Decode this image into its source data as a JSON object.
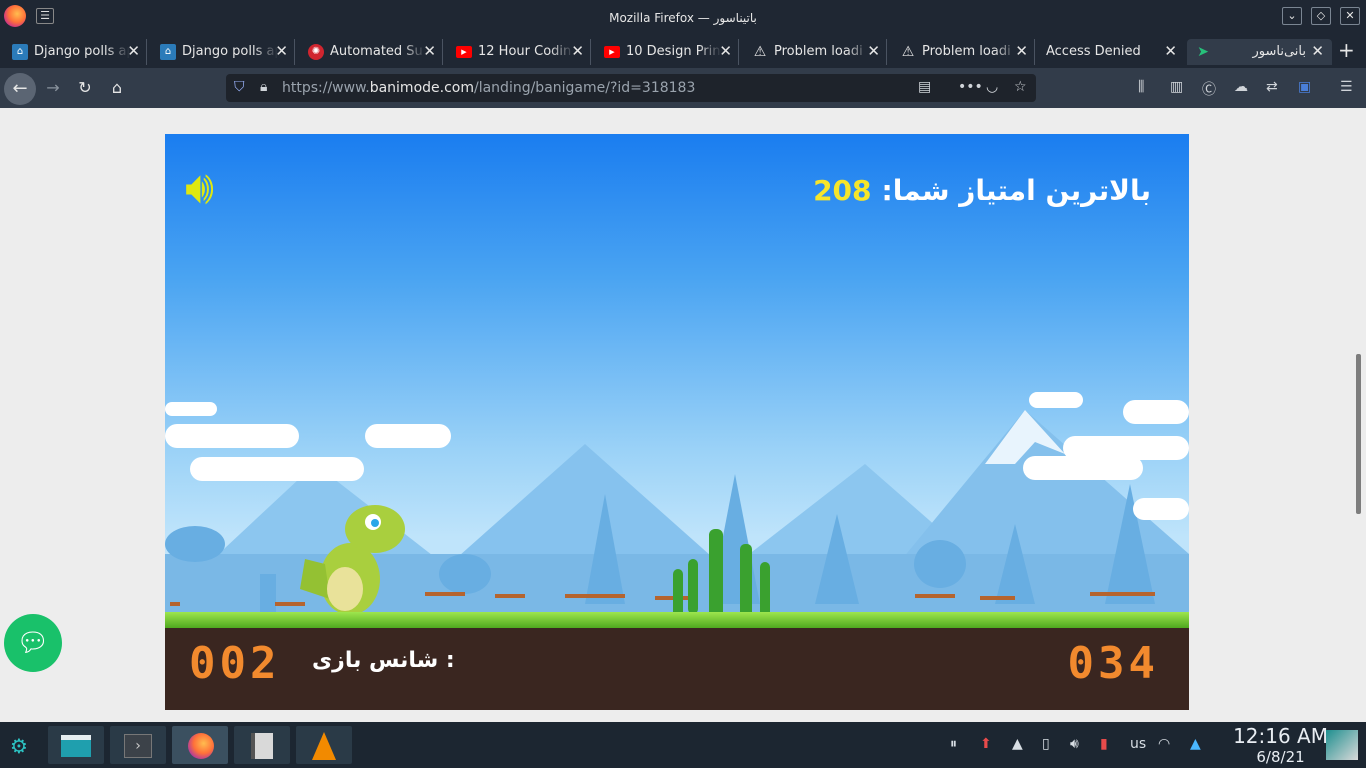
{
  "window": {
    "title": "Mozilla Firefox — باتیناسور"
  },
  "tabs": [
    {
      "label": "Django polls app",
      "fav_color": "#2b7bb9"
    },
    {
      "label": "Django polls app",
      "fav_color": "#2b7bb9"
    },
    {
      "label": "Automated Su",
      "fav_color": "#d0252f"
    },
    {
      "label": "12 Hour Codin",
      "fav_color": "#ff0000"
    },
    {
      "label": "10 Design Prin",
      "fav_color": "#ff0000"
    },
    {
      "label": "Problem loadi",
      "fav_color": "#333333"
    },
    {
      "label": "Problem loadi",
      "fav_color": "#333333"
    },
    {
      "label": "Access Denied",
      "fav_color": ""
    },
    {
      "label": "بانی‌ناسور",
      "fav_color": "#27c07a"
    }
  ],
  "url": {
    "prefix": "https://www.",
    "host": "banimode.com",
    "path": "/landing/banigame/?id=318183"
  },
  "game": {
    "high_score_label": "بالاترین امتیاز شما:",
    "high_score": "208",
    "chance_label": "شانس بازی :",
    "chance_value": "002",
    "current_score": "034"
  },
  "taskbar": {
    "time": "12:16 AM",
    "date": "6/8/21",
    "keyboard": "us"
  }
}
